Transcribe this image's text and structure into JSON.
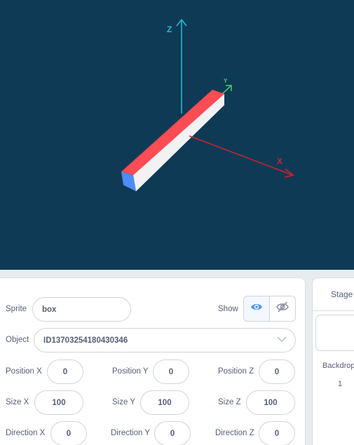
{
  "stage_view": {
    "axes": {
      "z": "Z",
      "y": "Y",
      "x": "X"
    },
    "colors": {
      "background": "#0e3a56",
      "z_axis": "#1fc0d0",
      "y_axis": "#4cd068",
      "x_axis": "#d2212a",
      "box_top": "#fd4c53",
      "box_side": "#f2f2f4",
      "box_end": "#4e8cf7"
    }
  },
  "sprite": {
    "sprite_label": "Sprite",
    "sprite_name": "box",
    "show_label": "Show",
    "show_icon": "eye-icon",
    "hide_icon": "eye-slash-icon",
    "object_label": "Object",
    "object_value": "ID13703254180430346",
    "position": {
      "x_label": "Position X",
      "x": "0",
      "y_label": "Position Y",
      "y": "0",
      "z_label": "Position Z",
      "z": "0"
    },
    "size": {
      "x_label": "Size X",
      "x": "100",
      "y_label": "Size Y",
      "y": "100",
      "z_label": "Size Z",
      "z": "100"
    },
    "direction": {
      "x_label": "Direction X",
      "x": "0",
      "y_label": "Direction Y",
      "y": "0",
      "z_label": "Direction Z",
      "z": "0"
    }
  },
  "stage_panel": {
    "title": "Stage",
    "backdrops_label": "Backdrop",
    "backdrops_count": "1"
  }
}
